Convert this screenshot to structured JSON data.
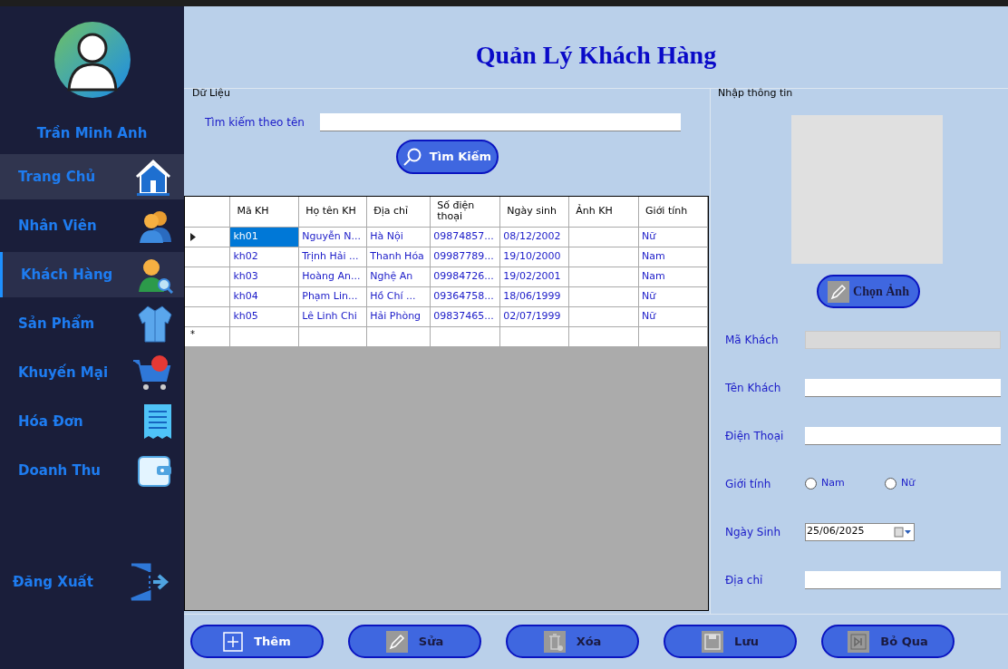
{
  "sidebar": {
    "user_name": "Trần Minh Anh",
    "items": [
      {
        "label": "Trang Chủ",
        "selected": false,
        "hovered": true
      },
      {
        "label": "Nhân Viên",
        "selected": false,
        "hovered": false
      },
      {
        "label": "Khách Hàng",
        "selected": true,
        "hovered": false
      },
      {
        "label": "Sản Phẩm",
        "selected": false,
        "hovered": false
      },
      {
        "label": "Khuyến Mại",
        "selected": false,
        "hovered": false
      },
      {
        "label": "Hóa Đơn",
        "selected": false,
        "hovered": false
      },
      {
        "label": "Doanh Thu",
        "selected": false,
        "hovered": false
      }
    ],
    "logout": "Đăng Xuất"
  },
  "title": "Quản Lý Khách Hàng",
  "data_group": {
    "title": "Dữ Liệu",
    "search_label": "Tìm kiếm theo tên",
    "search_button": "Tìm Kiếm",
    "table": {
      "columns": [
        "Mã KH",
        "Họ tên KH",
        "Địa chỉ",
        "Số điện thoại",
        "Ngày sinh",
        "Ảnh KH",
        "Giới tính"
      ],
      "rows": [
        {
          "selected": true,
          "cells": [
            "kh01",
            "Nguyễn N...",
            "Hà Nội",
            "09874857...",
            "08/12/2002",
            "",
            "Nữ"
          ]
        },
        {
          "selected": false,
          "cells": [
            "kh02",
            "Trịnh Hải ...",
            "Thanh Hóa",
            "09987789...",
            "19/10/2000",
            "",
            "Nam"
          ]
        },
        {
          "selected": false,
          "cells": [
            "kh03",
            "Hoàng An...",
            "Nghệ An",
            "09984726...",
            "19/02/2001",
            "",
            "Nam"
          ]
        },
        {
          "selected": false,
          "cells": [
            "kh04",
            "Phạm Lin...",
            "Hồ Chí ...",
            "09364758...",
            "18/06/1999",
            "",
            "Nữ"
          ]
        },
        {
          "selected": false,
          "cells": [
            "kh05",
            "Lê Linh Chi",
            "Hải Phòng",
            "09837465...",
            "02/07/1999",
            "",
            "Nữ"
          ]
        }
      ],
      "new_row_marker": "*"
    }
  },
  "input_group": {
    "title": "Nhập thông tin",
    "choose_image_button": "Chọn Ảnh",
    "fields": [
      {
        "kind": "text",
        "label": "Mã Khách",
        "disabled": true
      },
      {
        "kind": "text",
        "label": "Tên Khách",
        "disabled": false
      },
      {
        "kind": "text",
        "label": "Điện Thoại",
        "disabled": false
      },
      {
        "kind": "radio",
        "label": "Giới tính",
        "options": [
          {
            "label": "Nam",
            "checked": false
          },
          {
            "label": "Nữ",
            "checked": false
          }
        ]
      },
      {
        "kind": "date",
        "label": "Ngày Sinh",
        "value": "25/06/2025"
      },
      {
        "kind": "text",
        "label": "Địa chỉ",
        "disabled": false
      }
    ]
  },
  "buttons": [
    "Thêm",
    "Sửa",
    "Xóa",
    "Lưu",
    "Bỏ Qua"
  ]
}
